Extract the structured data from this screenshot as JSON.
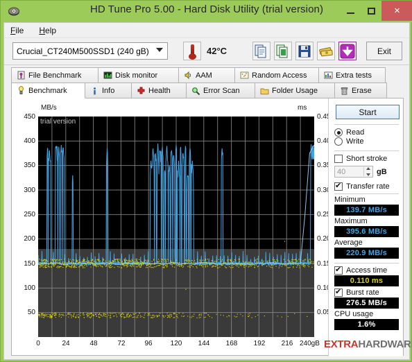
{
  "window": {
    "title": "HD Tune Pro 5.00 - Hard Disk Utility (trial version)",
    "icon": "harddisk-icon",
    "minimize_label": "Minimize",
    "maximize_label": "Maximize",
    "close_label": "×",
    "titlebar_color": "#9ccb5a",
    "close_color": "#cb5a5a"
  },
  "menu": {
    "items": [
      {
        "label": "File"
      },
      {
        "label": "Help"
      }
    ]
  },
  "toolbar": {
    "drive": "Crucial_CT240M500SSD1 (240 gB)",
    "temperature": "42°C",
    "buttons": [
      {
        "name": "copy-icon",
        "label": "Copy"
      },
      {
        "name": "copy-excel-icon",
        "label": "Copy to spreadsheet"
      },
      {
        "name": "save-icon",
        "label": "Save"
      },
      {
        "name": "money-icon",
        "label": "Buy"
      },
      {
        "name": "download-icon",
        "label": "Download"
      }
    ],
    "exit_label": "Exit"
  },
  "tabs": {
    "row1": [
      {
        "label": "File Benchmark",
        "icon": "file-benchmark-icon",
        "active": false
      },
      {
        "label": "Disk monitor",
        "icon": "disk-monitor-icon",
        "active": false
      },
      {
        "label": "AAM",
        "icon": "speaker-icon",
        "active": false
      },
      {
        "label": "Random Access",
        "icon": "random-access-icon",
        "active": false
      },
      {
        "label": "Extra tests",
        "icon": "extra-tests-icon",
        "active": false
      }
    ],
    "row2": [
      {
        "label": "Benchmark",
        "icon": "benchmark-icon",
        "active": true
      },
      {
        "label": "Info",
        "icon": "info-icon",
        "active": false
      },
      {
        "label": "Health",
        "icon": "health-icon",
        "active": false
      },
      {
        "label": "Error Scan",
        "icon": "error-scan-icon",
        "active": false
      },
      {
        "label": "Folder Usage",
        "icon": "folder-icon",
        "active": false
      },
      {
        "label": "Erase",
        "icon": "trash-icon",
        "active": false
      }
    ]
  },
  "sidebar": {
    "start_label": "Start",
    "mode": {
      "read_label": "Read",
      "write_label": "Write",
      "selected": "Read"
    },
    "short_stroke": {
      "label": "Short stroke",
      "checked": false,
      "value": "40",
      "unit": "gB"
    },
    "transfer_rate": {
      "label": "Transfer rate",
      "checked": true,
      "minimum_label": "Minimum",
      "minimum_value": "139.7 MB/s",
      "maximum_label": "Maximum",
      "maximum_value": "395.6 MB/s",
      "average_label": "Average",
      "average_value": "220.9 MB/s"
    },
    "access_time": {
      "label": "Access time",
      "checked": true,
      "value": "0.110 ms"
    },
    "burst_rate": {
      "label": "Burst rate",
      "checked": true,
      "value": "276.5 MB/s"
    },
    "cpu_usage": {
      "label": "CPU usage",
      "value": "1.6%"
    }
  },
  "watermark": {
    "part1": "EXTRA",
    "part2": "HARDWARE"
  },
  "chart_data": {
    "type": "line",
    "title": "",
    "watermark_text": "trial version",
    "xlabel": "gB",
    "ylabel": "MB/s",
    "y2label": "ms",
    "xlim": [
      0,
      240
    ],
    "ylim": [
      0,
      450
    ],
    "y2lim": [
      0,
      0.45
    ],
    "grid": true,
    "x_ticks": [
      "0",
      "24",
      "48",
      "72",
      "96",
      "120",
      "144",
      "168",
      "192",
      "216",
      "240gB"
    ],
    "y_ticks_left": [
      "450",
      "400",
      "350",
      "300",
      "250",
      "200",
      "150",
      "100",
      "50"
    ],
    "y_ticks_right": [
      "0.45",
      "0.40",
      "0.35",
      "0.30",
      "0.25",
      "0.20",
      "0.15",
      "0.10",
      "0.05"
    ],
    "series": [
      {
        "name": "Transfer rate",
        "color": "#3ea5e6",
        "unit": "MB/s",
        "axis": "left",
        "baseline": 150,
        "description": "Read transfer rate across 240 gB, baseline ~150 MB/s with frequent spikes to 200-395 MB/s",
        "x": [
          0,
          2,
          4,
          6,
          8,
          10,
          12,
          14,
          16,
          18,
          20,
          22,
          24,
          26,
          28,
          30,
          32,
          34,
          36,
          38,
          40,
          42,
          44,
          46,
          48,
          50,
          52,
          54,
          56,
          58,
          60,
          62,
          64,
          66,
          68,
          70,
          72,
          74,
          76,
          78,
          80,
          82,
          84,
          86,
          88,
          90,
          92,
          94,
          96,
          98,
          100,
          102,
          104,
          106,
          108,
          110,
          112,
          114,
          116,
          118,
          120,
          122,
          124,
          126,
          128,
          130,
          132,
          134,
          136,
          138,
          140,
          142,
          144,
          146,
          148,
          150,
          152,
          154,
          156,
          158,
          160,
          162,
          164,
          166,
          168,
          170,
          172,
          174,
          176,
          178,
          180,
          182,
          184,
          186,
          188,
          190,
          192,
          194,
          196,
          198,
          200,
          202,
          204,
          206,
          208,
          210,
          212,
          214,
          216,
          218,
          220,
          222,
          224,
          226,
          228,
          230,
          232,
          234,
          236,
          238,
          240
        ],
        "y": [
          150,
          152,
          148,
          150,
          385,
          380,
          150,
          148,
          390,
          388,
          392,
          386,
          150,
          150,
          152,
          330,
          148,
          150,
          150,
          150,
          152,
          150,
          148,
          150,
          150,
          152,
          150,
          148,
          150,
          150,
          385,
          150,
          148,
          150,
          152,
          150,
          150,
          148,
          150,
          150,
          152,
          150,
          148,
          150,
          150,
          152,
          150,
          148,
          150,
          360,
          385,
          375,
          395,
          380,
          388,
          340,
          390,
          350,
          380,
          370,
          392,
          360,
          388,
          375,
          390,
          330,
          385,
          360,
          150,
          150,
          152,
          150,
          148,
          150,
          150,
          152,
          150,
          148,
          150,
          150,
          385,
          152,
          148,
          150,
          150,
          152,
          150,
          148,
          150,
          150,
          152,
          150,
          148,
          150,
          150,
          152,
          150,
          148,
          150,
          150,
          152,
          150,
          148,
          150,
          150,
          152,
          150,
          148,
          150,
          150,
          152,
          150,
          148,
          150,
          150,
          152,
          150,
          148,
          150,
          395,
          395
        ]
      },
      {
        "name": "Access time",
        "color": "#ddd600",
        "unit": "ms",
        "axis": "right",
        "description": "Access time samples scattered around 0.11 ms (plotted as yellow dots near 145-155 MB/s equivalent) plus a secondary low band near 45",
        "average": 0.11
      }
    ]
  }
}
